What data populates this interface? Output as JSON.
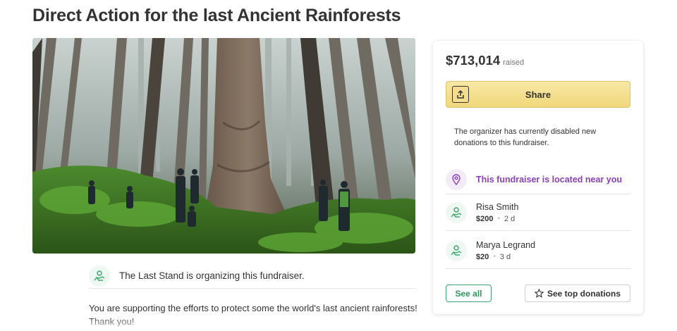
{
  "page": {
    "title": "Direct Action for the last Ancient Rainforests"
  },
  "organizer": {
    "text": "The Last Stand is organizing this fundraiser."
  },
  "description": {
    "text": "You are supporting the efforts to protect some the world's last ancient rainforests! Thank you!"
  },
  "panel": {
    "raised_amount": "$713,014",
    "raised_label": "raised",
    "share_label": "Share",
    "notice": "The organizer has currently disabled new donations to this fundraiser.",
    "location_text": "This fundraiser is located near you",
    "donations": [
      {
        "name": "Risa Smith",
        "amount": "$200",
        "time": "2 d"
      },
      {
        "name": "Marya Legrand",
        "amount": "$20",
        "time": "3 d"
      }
    ],
    "see_all_label": "See all",
    "top_donations_label": "See top donations"
  },
  "icons": {
    "share": "share-icon",
    "location": "location-pin-icon",
    "donor": "donor-hand-heart-icon",
    "organizer": "organizer-hand-heart-icon",
    "star": "star-icon"
  },
  "colors": {
    "share_button": "#f1d77a",
    "accent_green": "#2b9a5d",
    "location_purple": "#8c3fb8"
  }
}
